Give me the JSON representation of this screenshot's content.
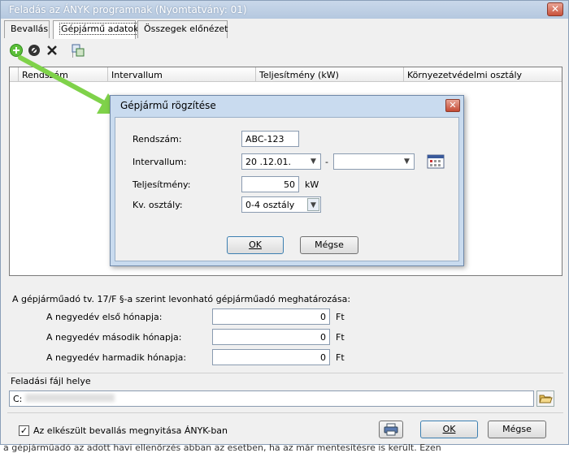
{
  "window": {
    "title": "Feladás az ÁNYK programnak (Nyomtatvány:    01)",
    "close_glyph": "✕"
  },
  "tabs": [
    {
      "label": "Bevallás"
    },
    {
      "label": "Gépjármű adatok"
    },
    {
      "label": "Összegek előnézet"
    }
  ],
  "toolbar": {
    "icons": [
      "add-icon",
      "edit-icon",
      "delete-icon",
      "copy-icon"
    ],
    "colors": {
      "add": "#3aa83a"
    }
  },
  "grid": {
    "columns": [
      "Rendszám",
      "Intervallum",
      "Teljesítmény (kW)",
      "Környezetvédelmi osztály"
    ]
  },
  "dialog": {
    "title": "Gépjármű rögzítése",
    "close_glyph": "✕",
    "rendszam_label": "Rendszám:",
    "rendszam_value": "ABC-123",
    "intervallum_label": "Intervallum:",
    "intervallum_from": "20    .12.01.",
    "intervallum_dash": "-",
    "intervallum_to": "",
    "teljesitmeny_label": "Teljesítmény:",
    "teljesitmeny_value": "50",
    "teljesitmeny_unit": "kW",
    "kv_label": "Kv. osztály:",
    "kv_value": "0-4 osztály",
    "ok_label": "OK",
    "cancel_label": "Mégse"
  },
  "deduction": {
    "heading": "A gépjárműadó tv. 17/F §-a szerint levonható gépjárműadó meghatározása:",
    "rows": [
      {
        "label": "A negyedév első hónapja:",
        "value": "0",
        "unit": "Ft"
      },
      {
        "label": "A negyedév második hónapja:",
        "value": "0",
        "unit": "Ft"
      },
      {
        "label": "A negyedév harmadik hónapja:",
        "value": "0",
        "unit": "Ft"
      }
    ]
  },
  "file": {
    "heading": "Feladási fájl helye",
    "path_prefix": "C:"
  },
  "footer": {
    "checkbox_label": "Az elkészült bevallás megnyitása ÁNYK-ban",
    "checkbox_checked": true,
    "check_glyph": "✓",
    "ok_label": "OK",
    "cancel_label": "Mégse"
  },
  "below_text": "a gépjárműadó az adott havi ellenőrzés abban az esetben, ha az már mentesítésre is került. Ezen"
}
